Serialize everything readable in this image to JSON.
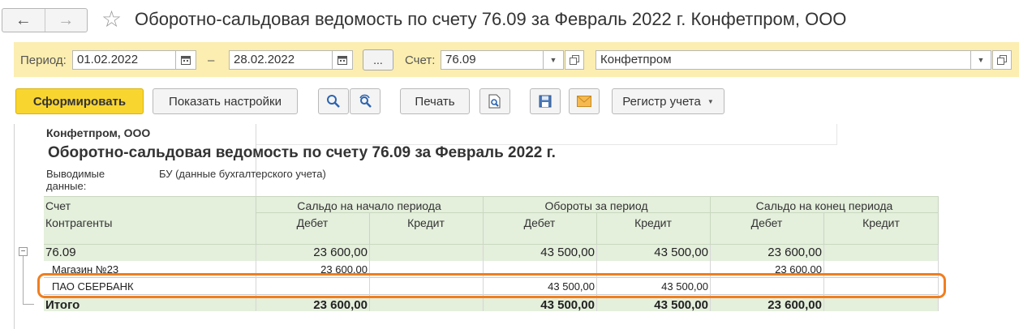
{
  "window": {
    "title": "Оборотно-сальдовая ведомость по счету 76.09 за Февраль 2022 г. Конфетпром, ООО",
    "back_glyph": "←",
    "forward_glyph": "→",
    "favorite_glyph": "☆"
  },
  "params": {
    "period_label": "Период:",
    "date_from": "01.02.2022",
    "dash": "–",
    "date_to": "28.02.2022",
    "dots_label": "...",
    "account_label": "Счет:",
    "account_value": "76.09",
    "org_value": "Конфетпром"
  },
  "toolbar": {
    "generate_label": "Сформировать",
    "settings_label": "Показать настройки",
    "print_label": "Печать",
    "register_label": "Регистр учета"
  },
  "report": {
    "org": "Конфетпром, ООО",
    "title": "Оборотно-сальдовая ведомость по счету 76.09 за Февраль 2022 г.",
    "output_label": "Выводимые данные:",
    "output_value": "БУ (данные бухгалтерского учета)",
    "header": {
      "account": "Счет",
      "counterparties": "Контрагенты",
      "opening": "Сальдо на начало периода",
      "turnover": "Обороты за период",
      "closing": "Сальдо на конец периода",
      "debit": "Дебет",
      "credit": "Кредит"
    },
    "collapse_glyph": "−",
    "rows": [
      {
        "name": "76.09",
        "open_debit": "23 600,00",
        "open_credit": "",
        "turn_debit": "43 500,00",
        "turn_credit": "43 500,00",
        "close_debit": "23 600,00",
        "close_credit": ""
      },
      {
        "name": "Магазин №23",
        "open_debit": "23 600,00",
        "open_credit": "",
        "turn_debit": "",
        "turn_credit": "",
        "close_debit": "23 600,00",
        "close_credit": ""
      },
      {
        "name": "ПАО СБЕРБАНК",
        "open_debit": "",
        "open_credit": "",
        "turn_debit": "43 500,00",
        "turn_credit": "43 500,00",
        "close_debit": "",
        "close_credit": ""
      },
      {
        "name": "Итого",
        "open_debit": "23 600,00",
        "open_credit": "",
        "turn_debit": "43 500,00",
        "turn_credit": "43 500,00",
        "close_debit": "23 600,00",
        "close_credit": ""
      }
    ]
  },
  "colors": {
    "panel": "#fbeeb0",
    "primary_button": "#f9d52f",
    "table_header": "#e4efdc",
    "highlight": "#f07e20"
  }
}
